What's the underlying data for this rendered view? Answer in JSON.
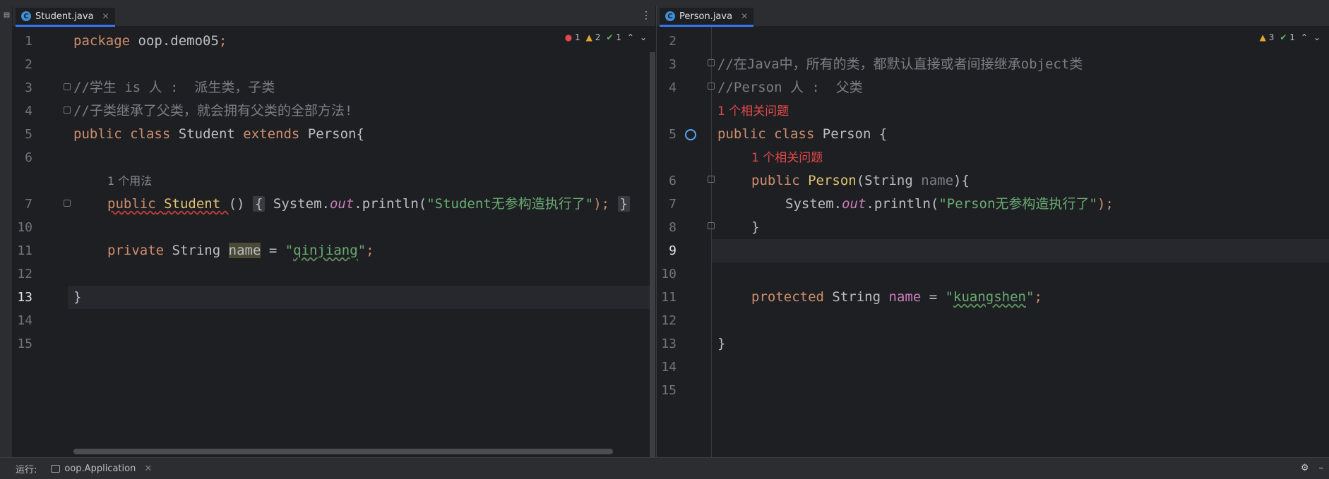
{
  "left_pane": {
    "tab": {
      "label": "Student.java",
      "icon": "c-class-icon"
    },
    "inspection": {
      "errors": "1",
      "warnings": "2",
      "ok": "1"
    },
    "lines": [
      {
        "num": "1"
      },
      {
        "num": "2"
      },
      {
        "num": "3"
      },
      {
        "num": "4"
      },
      {
        "num": "5"
      },
      {
        "num": "6"
      },
      {
        "num": "7"
      },
      {
        "num": "10"
      },
      {
        "num": "11"
      },
      {
        "num": "12"
      },
      {
        "num": "13"
      },
      {
        "num": "14"
      },
      {
        "num": "15"
      }
    ],
    "code": {
      "l1_kw": "package",
      "l1_rest": " oop.demo05",
      "l3": "//学生 is 人 :  派生类，子类",
      "l4": "//子类继承了父类，就会拥有父类的全部方法!",
      "l5_kw1": "public",
      "l5_kw2": "class",
      "l5_name": "Student",
      "l5_kw3": "extends",
      "l5_parent": "Person{",
      "hint_usage": "1 个用法",
      "l7_kw": "public",
      "l7_ctor": "Student",
      "l7_paren": "()",
      "l7_open": "{",
      "l7_sys": "System.",
      "l7_out": "out",
      "l7_println": ".println(",
      "l7_str": "\"Student无参构造执行了\"",
      "l7_end": ");",
      "l7_close": "}",
      "l11_kw": "private",
      "l11_type": "String",
      "l11_name": "name",
      "l11_eq": " = ",
      "l11_q1": "\"",
      "l11_val": "qinjiang",
      "l11_q2": "\"",
      "l11_semi": ";",
      "l13": "}"
    }
  },
  "right_pane": {
    "tab": {
      "label": "Person.java",
      "icon": "c-class-icon"
    },
    "inspection": {
      "warnings": "3",
      "ok": "1"
    },
    "lines": [
      {
        "num": "2"
      },
      {
        "num": "3"
      },
      {
        "num": "4"
      },
      {
        "num": "5"
      },
      {
        "num": "6"
      },
      {
        "num": "7"
      },
      {
        "num": "8"
      },
      {
        "num": "9"
      },
      {
        "num": "10"
      },
      {
        "num": "11"
      },
      {
        "num": "12"
      },
      {
        "num": "13"
      },
      {
        "num": "14"
      },
      {
        "num": "15"
      }
    ],
    "code": {
      "l3": "//在Java中，所有的类，都默认直接或者间接继承object类",
      "l4": "//Person 人 :  父类",
      "hint_problem1": "1 个相关问题",
      "l5_kw1": "public",
      "l5_kw2": "class",
      "l5_name": "Person {",
      "hint_problem2": "1 个相关问题",
      "l6_kw": "public",
      "l6_ctor": "Person",
      "l6_open": "(String ",
      "l6_param": "name",
      "l6_close": "){",
      "l7_sys": "System.",
      "l7_out": "out",
      "l7_println": ".println(",
      "l7_str": "\"Person无参构造执行了\"",
      "l7_end": ");",
      "l8": "}",
      "l11_kw": "protected",
      "l11_type": "String",
      "l11_name": "name",
      "l11_eq": " = ",
      "l11_q1": "\"",
      "l11_val": "kuangshen",
      "l11_q2": "\"",
      "l11_semi": ";",
      "l13": "}"
    }
  },
  "run_bar": {
    "label": "运行:",
    "tab_label": "oop.Application"
  },
  "colors": {
    "keyword": "#cf8e6d",
    "string": "#6aab73",
    "comment": "#7a7e85",
    "ctor": "#e0c56e",
    "field": "#c77dbb",
    "error": "#e0494b",
    "warning": "#e0a631",
    "ok": "#5fb865",
    "tab_accent": "#3574f0"
  }
}
